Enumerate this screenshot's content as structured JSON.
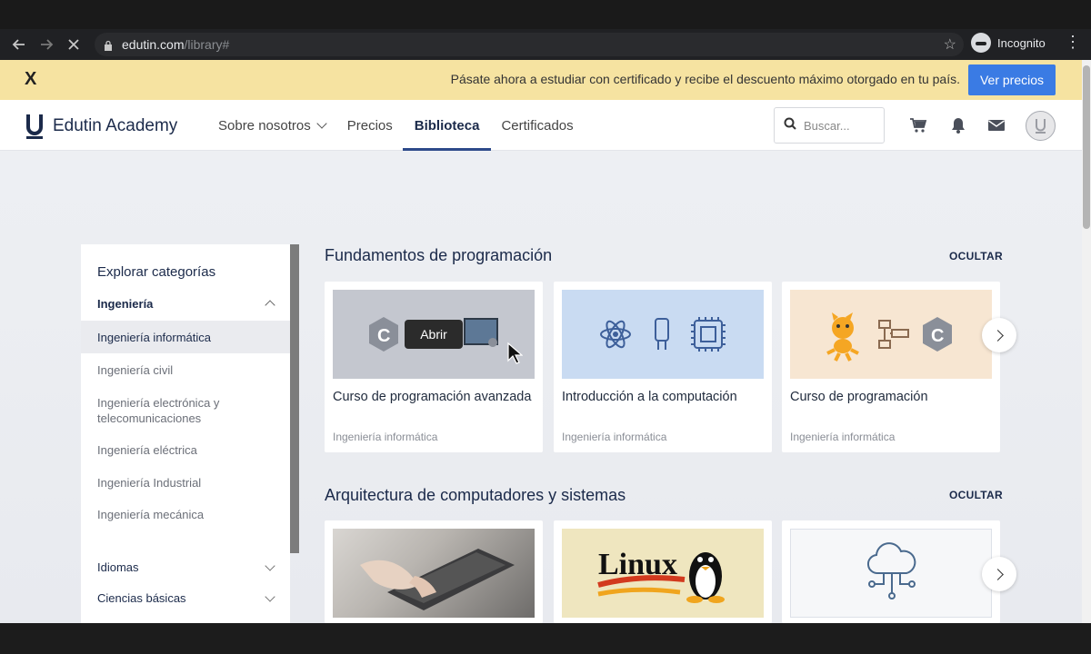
{
  "browser": {
    "url_host": "edutin.com",
    "url_path": "/library#",
    "profile_label": "Incognito"
  },
  "promo": {
    "close_label": "X",
    "message": "Pásate ahora a estudiar con certificado y recibe el descuento máximo otorgado en tu país.",
    "cta_label": "Ver precios"
  },
  "header": {
    "brand": "Edutin Academy",
    "nav": [
      {
        "label": "Sobre nosotros"
      },
      {
        "label": "Precios"
      },
      {
        "label": "Biblioteca"
      },
      {
        "label": "Certificados"
      }
    ],
    "search_placeholder": "Buscar..."
  },
  "sidebar": {
    "title": "Explorar categorías",
    "sections": [
      {
        "label": "Ingeniería"
      },
      {
        "label": "Idiomas"
      },
      {
        "label": "Ciencias básicas"
      }
    ],
    "items": [
      {
        "label": "Ingeniería informática"
      },
      {
        "label": "Ingeniería civil"
      },
      {
        "label": "Ingeniería electrónica y telecomunicaciones"
      },
      {
        "label": "Ingeniería eléctrica"
      },
      {
        "label": "Ingeniería Industrial"
      },
      {
        "label": "Ingeniería mecánica"
      }
    ]
  },
  "sections": [
    {
      "title": "Fundamentos de programación",
      "hide_label": "OCULTAR",
      "cards": [
        {
          "title": "Curso de programación avanzada",
          "category": "Ingeniería informática"
        },
        {
          "title": "Introducción a la computación",
          "category": "Ingeniería informática"
        },
        {
          "title": "Curso de programación",
          "category": "Ingeniería informática"
        }
      ]
    },
    {
      "title": "Arquitectura de computadores y sistemas",
      "hide_label": "OCULTAR",
      "cards": [
        {
          "title": "",
          "category": "",
          "thumb_text": ""
        },
        {
          "title": "",
          "category": "",
          "thumb_text": "Linux"
        },
        {
          "title": "",
          "category": "",
          "thumb_text": ""
        }
      ]
    }
  ],
  "tooltip": "Abrir",
  "colors": {
    "brand": "#1b2a4a",
    "accent": "#3a7be4",
    "promo_bg": "#f6e3a1",
    "nav_underline": "#2d4a8a"
  }
}
